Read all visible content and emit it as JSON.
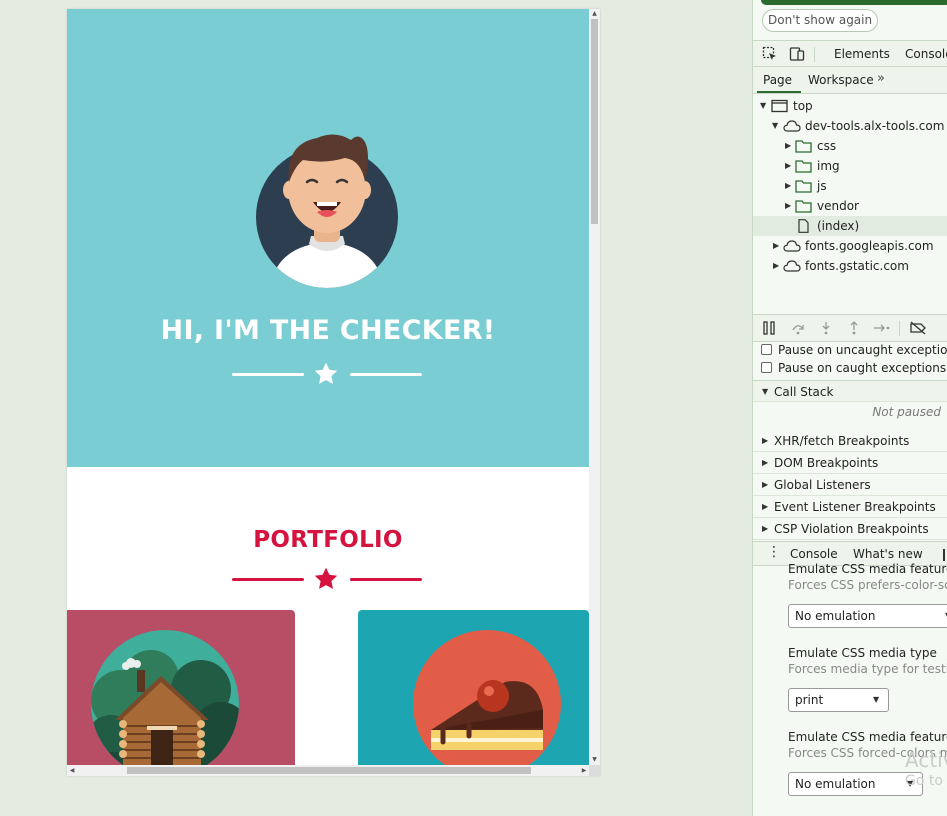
{
  "page": {
    "hero_title": "HI, I'M THE CHECKER!",
    "portfolio_title": "PORTFOLIO",
    "colors": {
      "hero_bg": "#7acdd2",
      "accent_red": "#d5133f",
      "card_cabin": "#b84d66",
      "card_cake": "#1ea5b2"
    },
    "icons": {
      "avatar": "smiling-person-avatar",
      "divider": "star-icon",
      "card1": "log-cabin-illustration",
      "card2": "cake-slice-illustration"
    }
  },
  "devtools": {
    "dont_show_again": "Don't show again",
    "main_tabs": [
      "Elements",
      "Console"
    ],
    "sub_tabs": [
      "Page",
      "Workspace"
    ],
    "tree": {
      "top": "top",
      "domain": "dev-tools.alx-tools.com",
      "folders": [
        "css",
        "img",
        "js",
        "vendor"
      ],
      "index": "(index)",
      "other_domains": [
        "fonts.googleapis.com",
        "fonts.gstatic.com"
      ]
    },
    "pause_uncaught": "Pause on uncaught exceptions",
    "pause_caught": "Pause on caught exceptions",
    "call_stack": "Call Stack",
    "not_paused": "Not paused",
    "breakpoints": [
      "XHR/fetch Breakpoints",
      "DOM Breakpoints",
      "Global Listeners",
      "Event Listener Breakpoints",
      "CSP Violation Breakpoints"
    ],
    "drawer_tabs": [
      "Console",
      "What's new"
    ],
    "rendering": {
      "feature1_title": "Emulate CSS media feature prefers-color-scheme",
      "feature1_desc": "Forces CSS prefers-color-scheme media feature",
      "feature1_value": "No emulation",
      "type_title": "Emulate CSS media type",
      "type_desc": "Forces media type for testing print and screen styles",
      "type_value": "print",
      "feature2_title": "Emulate CSS media feature forced-colors",
      "feature2_desc": "Forces CSS forced-colors media feature",
      "feature2_value": "No emulation"
    },
    "watermark": "Activ",
    "watermark2": "Go to"
  }
}
